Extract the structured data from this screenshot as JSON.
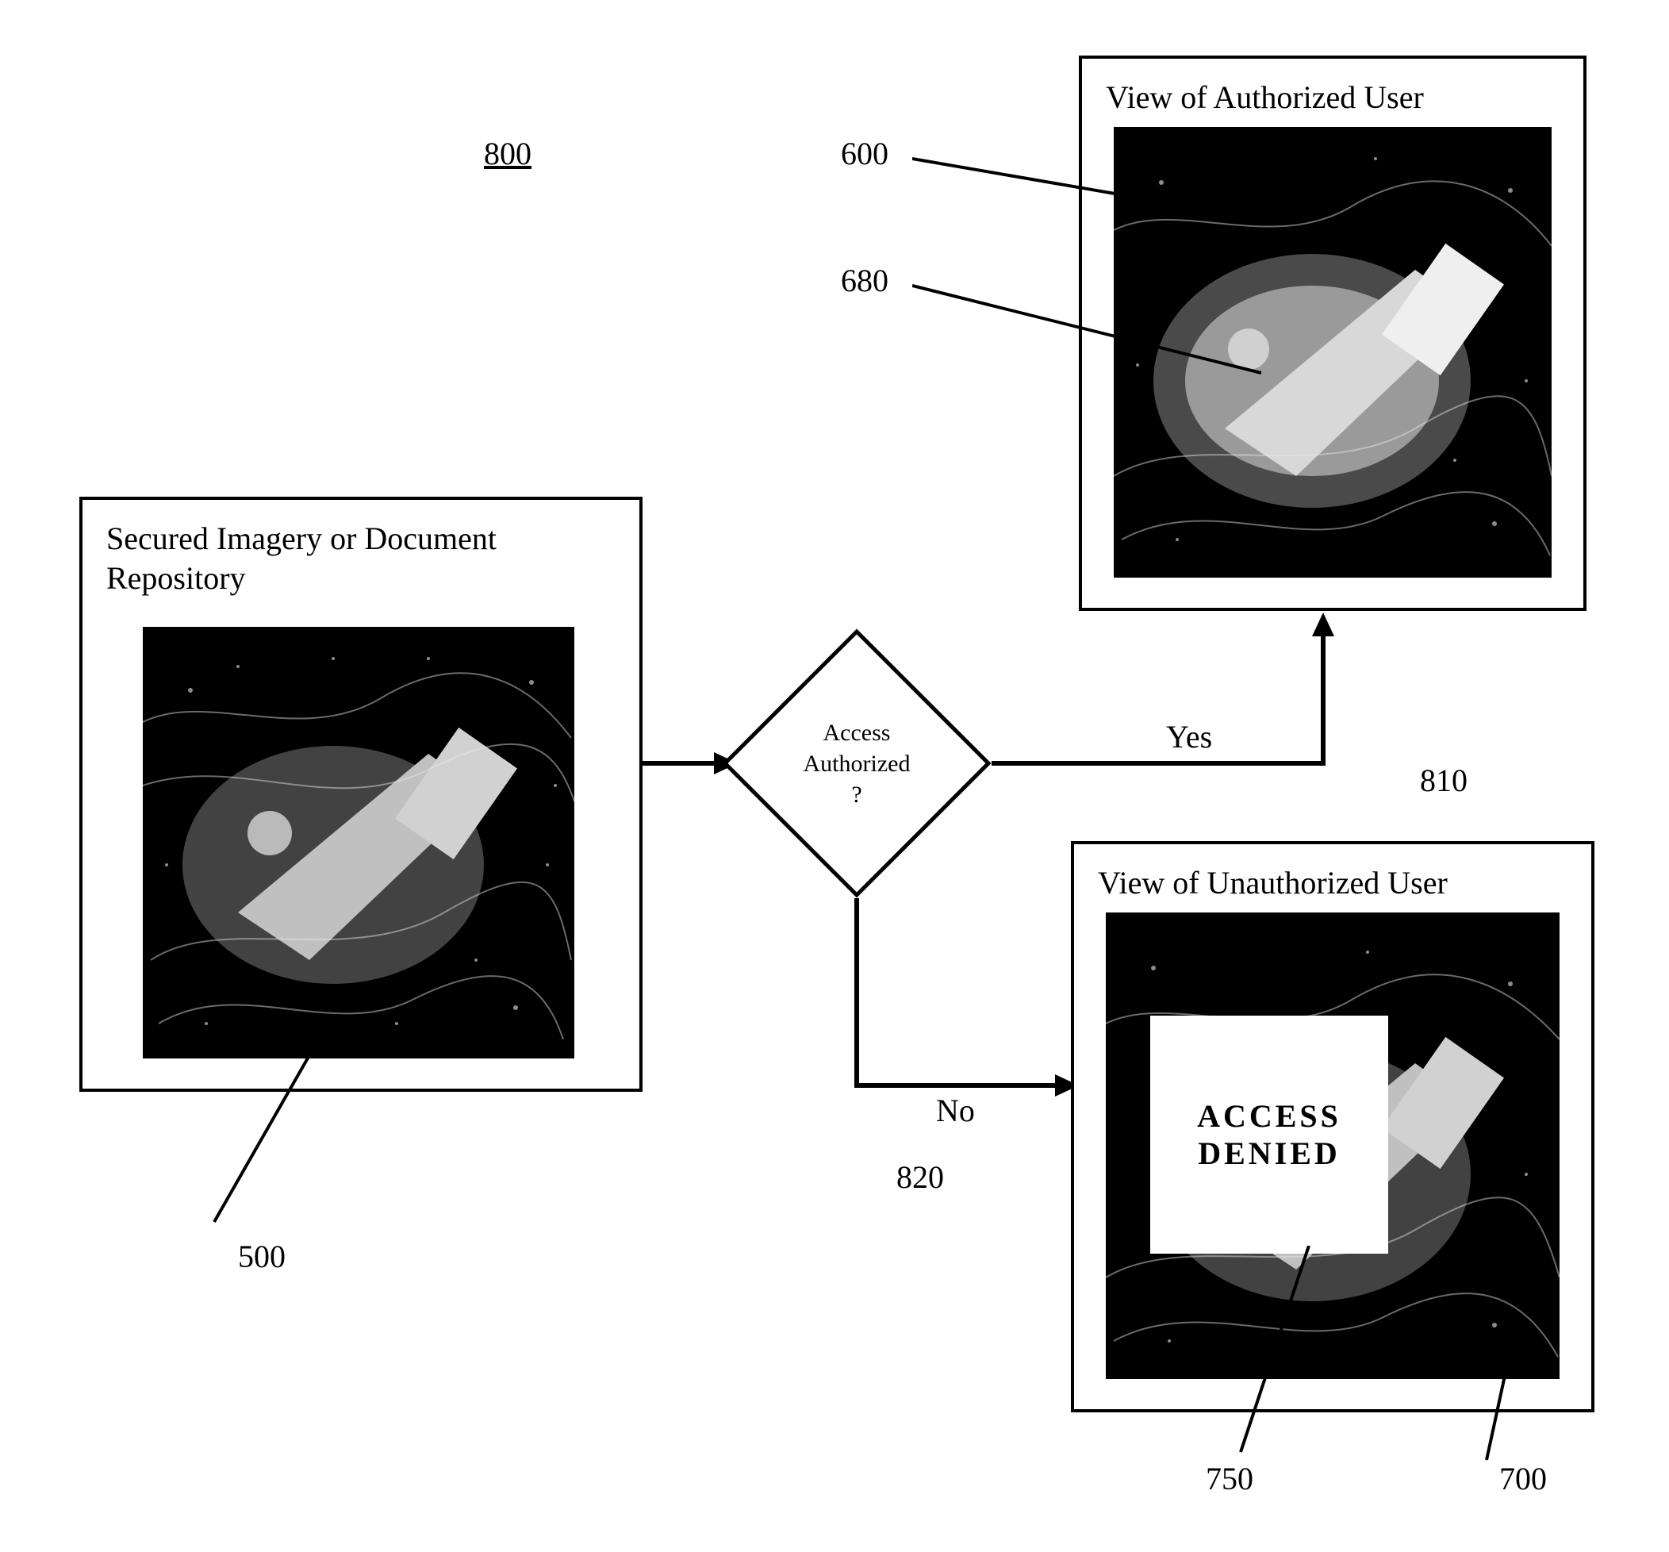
{
  "figure_ref": "800",
  "repository": {
    "title": "Secured Imagery or Document Repository",
    "image_ref": "500"
  },
  "decision": {
    "line1": "Access",
    "line2": "Authorized",
    "line3": "?"
  },
  "flow": {
    "yes": {
      "label": "Yes",
      "ref": "810"
    },
    "no": {
      "label": "No",
      "ref": "820"
    }
  },
  "authorized_view": {
    "title": "View of Authorized User",
    "image_ref": "600",
    "region_ref": "680"
  },
  "unauthorized_view": {
    "title": "View of Unauthorized User",
    "image_ref": "700",
    "overlay_ref": "750",
    "overlay_line1": "ACCESS",
    "overlay_line2": "DENIED"
  }
}
